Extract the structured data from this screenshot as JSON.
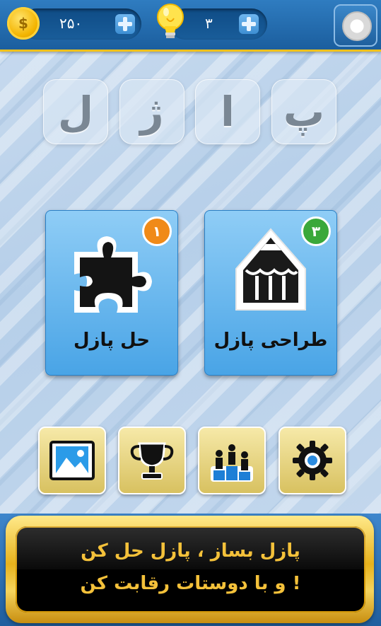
{
  "header": {
    "coins": "۲۵۰",
    "hints": "۳",
    "coin_icon_symbol": "$"
  },
  "title_letters": [
    "پ",
    "ا",
    "ژ",
    "ل"
  ],
  "cards": [
    {
      "label": "طراحی پازل",
      "badge": "۳",
      "badge_color": "#3aa83a",
      "icon": "pencil-icon"
    },
    {
      "label": "حل پازل",
      "badge": "۱",
      "badge_color": "#f08a18",
      "icon": "puzzle-icon"
    }
  ],
  "bottom_buttons": [
    {
      "icon": "settings-gear-icon"
    },
    {
      "icon": "leaderboard-podium-icon"
    },
    {
      "icon": "trophy-icon"
    },
    {
      "icon": "gallery-image-icon"
    }
  ],
  "banner": {
    "line1": "پازل بساز ، پازل حل کن",
    "line2": "و با دوستات رقابت کن !"
  }
}
